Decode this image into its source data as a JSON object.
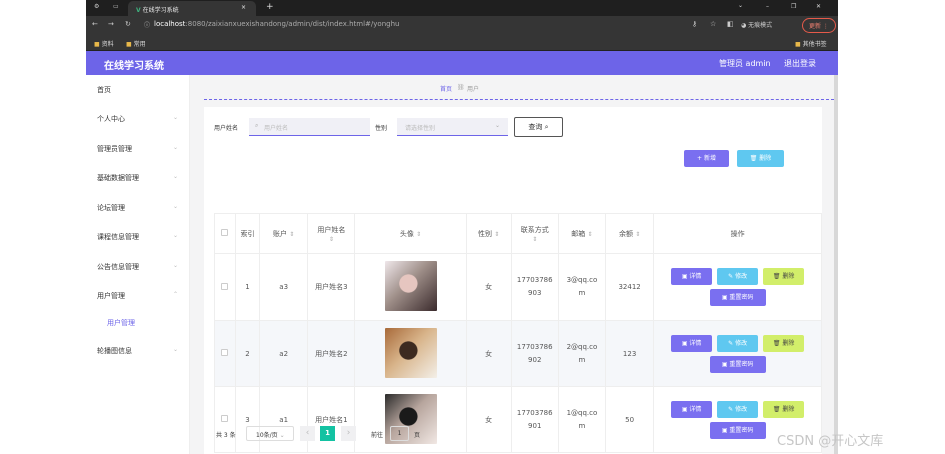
{
  "browser": {
    "tab_title": "在线学习系统",
    "tab_close": "×",
    "new_tab": "+",
    "url_host": "localhost",
    "url_rest": ":8080/zaixianxuexishandong/admin/dist/index.html#/yonghu",
    "incognito": "无痕模式",
    "update": "更新",
    "bookmarks": [
      "资料",
      "常用"
    ],
    "other_bookmarks": "其他书签",
    "win_min": "–",
    "win_max": "❐",
    "win_close": "✕",
    "chevron": "⌄"
  },
  "app": {
    "title": "在线学习系统",
    "user": "管理员 admin",
    "logout": "退出登录"
  },
  "sidebar": {
    "items": [
      {
        "label": "首页",
        "expand": ""
      },
      {
        "label": "个人中心",
        "expand": "⌄"
      },
      {
        "label": "管理员管理",
        "expand": "⌄"
      },
      {
        "label": "基础数据管理",
        "expand": "⌄"
      },
      {
        "label": "论坛管理",
        "expand": "⌄"
      },
      {
        "label": "课程信息管理",
        "expand": "⌄"
      },
      {
        "label": "公告信息管理",
        "expand": "⌄"
      },
      {
        "label": "用户管理",
        "expand": "⌃"
      },
      {
        "label": "用户管理",
        "expand": ""
      },
      {
        "label": "轮播图信息",
        "expand": "⌄"
      }
    ]
  },
  "breadcrumb": {
    "home": "首页",
    "separator": "⛓",
    "current": "用户"
  },
  "search": {
    "name_label": "用户姓名",
    "name_placeholder": "用户姓名",
    "gender_label": "性别",
    "gender_placeholder": "请选择性别",
    "query_button": "查询"
  },
  "actions": {
    "add": "+ 新增",
    "delete": "🗑 删除"
  },
  "table": {
    "headers": [
      "索引",
      "账户",
      "用户姓名",
      "头像",
      "性别",
      "联系方式",
      "邮箱",
      "余额",
      "操作"
    ],
    "rows": [
      {
        "index": "1",
        "account": "a3",
        "name": "用户姓名3",
        "gender": "女",
        "phone": "17703786903",
        "email": "3@qq.com",
        "balance": "32412",
        "photo_colors": [
          "#efe7ea",
          "#3a2a2c",
          "#e6c6c0",
          "#9e8e88"
        ]
      },
      {
        "index": "2",
        "account": "a2",
        "name": "用户姓名2",
        "gender": "女",
        "phone": "17703786902",
        "email": "2@qq.com",
        "balance": "123",
        "photo_colors": [
          "#a86a3a",
          "#f3efe8",
          "#3c2a20",
          "#d8b48a"
        ]
      },
      {
        "index": "3",
        "account": "a1",
        "name": "用户姓名1",
        "gender": "女",
        "phone": "17703786901",
        "email": "1@qq.com",
        "balance": "50",
        "photo_colors": [
          "#2b2b2b",
          "#f1e8e4",
          "#1a1a1a",
          "#b7a59d"
        ]
      }
    ],
    "ops": {
      "detail": "详情",
      "edit": "修改",
      "delete": "删除",
      "reset": "重置密码"
    }
  },
  "pagination": {
    "total": "共 3 条",
    "page_size": "10条/页",
    "current_page": "1",
    "goto_prefix": "前往",
    "goto_value": "1",
    "goto_suffix": "页",
    "prev": "‹",
    "next": "›"
  },
  "watermark": "CSDN @开心文库",
  "colors": {
    "header": "#6d64e8",
    "purple": "#7a6ff0",
    "blue": "#5fc8f0",
    "lime": "#d2ee6a",
    "page_active": "#13c2a2"
  }
}
